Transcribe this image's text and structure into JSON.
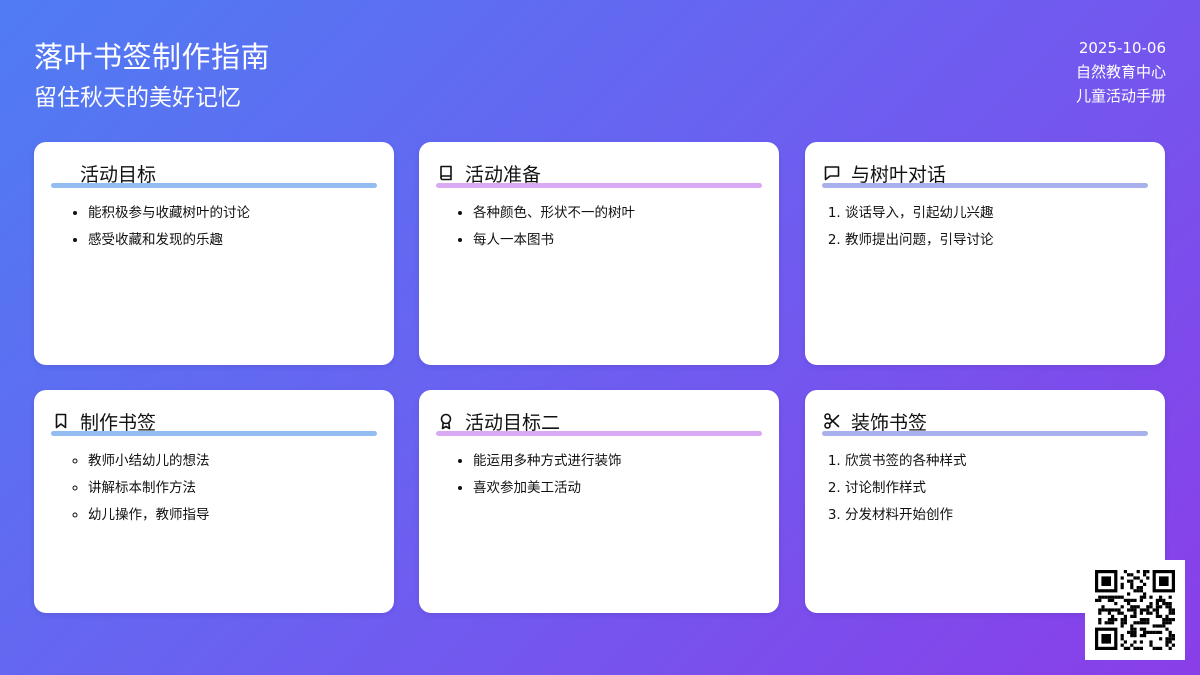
{
  "header": {
    "title": "落叶书签制作指南",
    "subtitle": "留住秋天的美好记忆",
    "date": "2025-10-06",
    "org": "自然教育中心",
    "handbook": "儿童活动手册"
  },
  "cards": [
    {
      "title": "活动目标",
      "icon": "none",
      "list_type": "bullet",
      "items": [
        "能积极参与收藏树叶的讨论",
        "感受收藏和发现的乐趣"
      ]
    },
    {
      "title": "活动准备",
      "icon": "book-icon",
      "list_type": "bullet",
      "items": [
        "各种颜色、形状不一的树叶",
        "每人一本图书"
      ]
    },
    {
      "title": "与树叶对话",
      "icon": "chat-icon",
      "list_type": "numbered",
      "items": [
        "谈话导入，引起幼儿兴趣",
        "教师提出问题，引导讨论"
      ]
    },
    {
      "title": "制作书签",
      "icon": "bookmark-icon",
      "list_type": "circle",
      "items": [
        "教师小结幼儿的想法",
        "讲解标本制作方法",
        "幼儿操作，教师指导"
      ]
    },
    {
      "title": "活动目标二",
      "icon": "award-icon",
      "list_type": "bullet",
      "items": [
        "能运用多种方式进行装饰",
        "喜欢参加美工活动"
      ]
    },
    {
      "title": "装饰书签",
      "icon": "scissors-icon",
      "list_type": "numbered",
      "items": [
        "欣赏书签的各种样式",
        "讨论制作样式",
        "分发材料开始创作"
      ]
    }
  ],
  "qr_code": {
    "icon": "qr-code-icon"
  },
  "colors": {
    "background_start": "#4f7cf3",
    "background_end": "#8a3ee8",
    "rule_blue": "#93bdf0",
    "rule_pink": "#d9a9f4",
    "rule_indigo": "#a9b0ee"
  }
}
